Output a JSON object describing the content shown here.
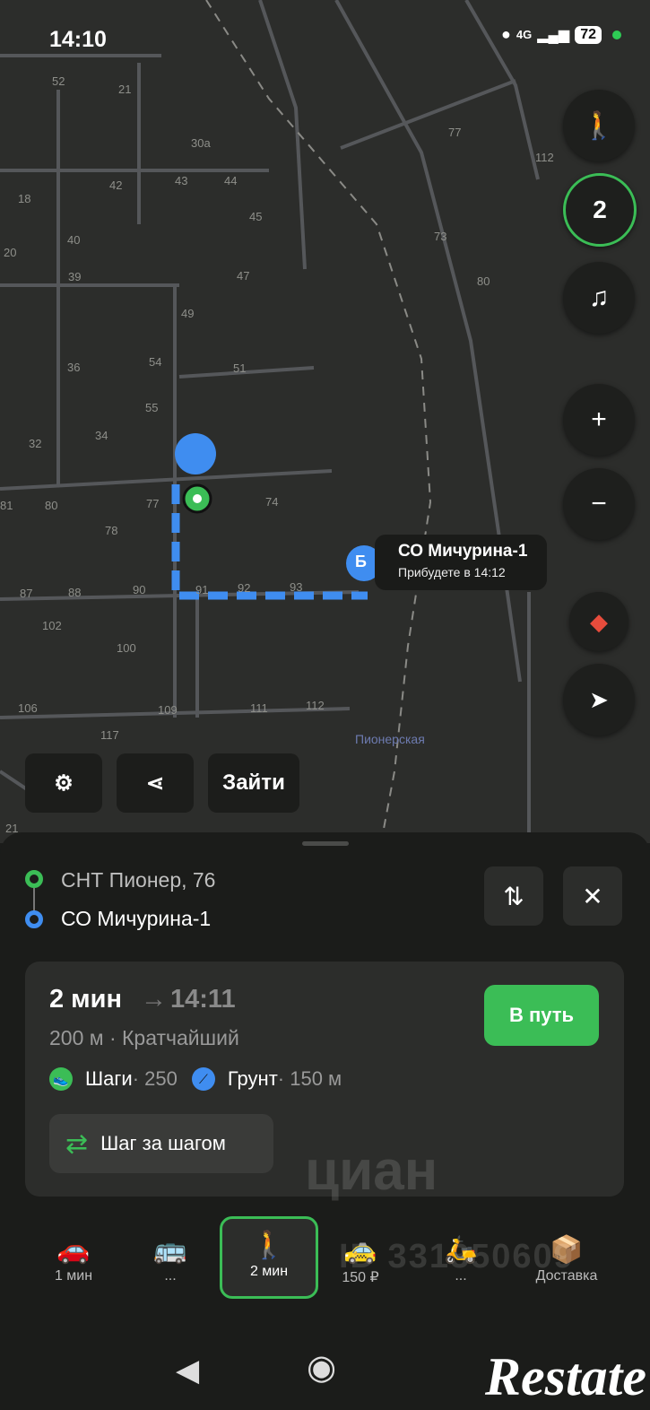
{
  "status_bar": {
    "time": "14:10",
    "network": "4G",
    "battery": "72"
  },
  "map": {
    "house_numbers": [
      "52",
      "21",
      "30а",
      "43",
      "44",
      "42",
      "18",
      "45",
      "20",
      "40",
      "39",
      "47",
      "73",
      "80",
      "77",
      "112",
      "49",
      "36",
      "54",
      "51",
      "55",
      "34",
      "32",
      "81",
      "80",
      "77",
      "74",
      "78",
      "87",
      "88",
      "90",
      "91",
      "92",
      "93",
      "102",
      "100",
      "106",
      "109",
      "111",
      "112",
      "117",
      "21"
    ],
    "destination_marker": "Б",
    "callout_title": "СО Мичурина-1",
    "callout_eta": "Прибудете в 14:12",
    "metro_label": "Пионерская",
    "fab_layers_count": "2"
  },
  "map_chips": {
    "enter_label": "Зайти"
  },
  "route": {
    "from": "СНТ Пионер, 76",
    "to": "СО Мичурина-1",
    "duration": "2 мин",
    "arrow": "→",
    "eta": "14:11",
    "summary": "200 м · Кратчайший",
    "steps_label": "Шаги",
    "steps_value": " · 250",
    "surface_label": "Грунт",
    "surface_value": " · 150 м",
    "go_label": "В путь",
    "step_by_step_label": "Шаг за шагом"
  },
  "modes": [
    {
      "icon": "car-icon",
      "label": "1 мин"
    },
    {
      "icon": "bus-icon",
      "label": "..."
    },
    {
      "icon": "walk-icon",
      "label": "2 мин"
    },
    {
      "icon": "taxi-icon",
      "label": "150 ₽"
    },
    {
      "icon": "scooter-icon",
      "label": "..."
    },
    {
      "icon": "delivery-icon",
      "label": "Доставка"
    }
  ],
  "watermark": {
    "brand": "циан",
    "id": "ID 331350609",
    "logo": "Restate"
  },
  "colors": {
    "accent_green": "#3bbd56",
    "route_blue": "#3f8df0",
    "map_bg": "#2c2d2b"
  }
}
